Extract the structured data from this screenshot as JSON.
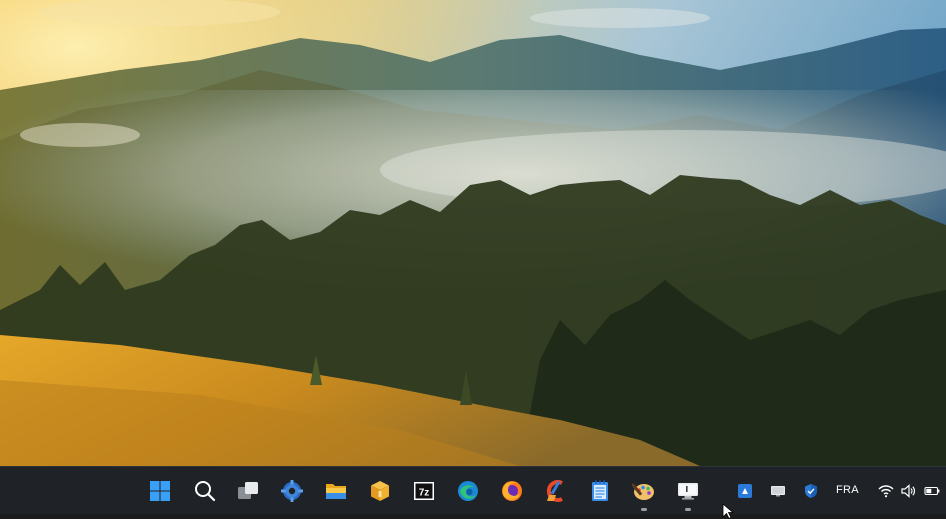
{
  "desktop": {
    "wallpaper": "misty-mountain-forest-sunrise"
  },
  "taskbar": {
    "background": "#1f2226",
    "pinned": [
      {
        "name": "start-button",
        "icon": "windows-logo-icon"
      },
      {
        "name": "search-button",
        "icon": "search-icon"
      },
      {
        "name": "task-view-button",
        "icon": "task-view-icon"
      },
      {
        "name": "settings-app",
        "icon": "gear-icon"
      },
      {
        "name": "file-explorer-app",
        "icon": "folder-icon"
      },
      {
        "name": "package-app",
        "icon": "box-icon"
      },
      {
        "name": "sevenzip-app",
        "icon": "7z-icon",
        "label": "7z"
      },
      {
        "name": "edge-app",
        "icon": "edge-icon"
      },
      {
        "name": "firefox-app",
        "icon": "firefox-icon"
      },
      {
        "name": "ccleaner-app",
        "icon": "ccleaner-icon"
      },
      {
        "name": "notepad-app",
        "icon": "notepad-icon"
      },
      {
        "name": "paint-app",
        "icon": "palette-icon",
        "running": true
      },
      {
        "name": "remote-desktop-app",
        "icon": "monitor-icon",
        "running": true
      }
    ],
    "tray": {
      "language": "FRA",
      "icons": [
        "app-tray-icon",
        "display-tray-icon",
        "defender-shield-icon",
        "wifi-icon",
        "speaker-icon",
        "battery-icon"
      ]
    }
  }
}
